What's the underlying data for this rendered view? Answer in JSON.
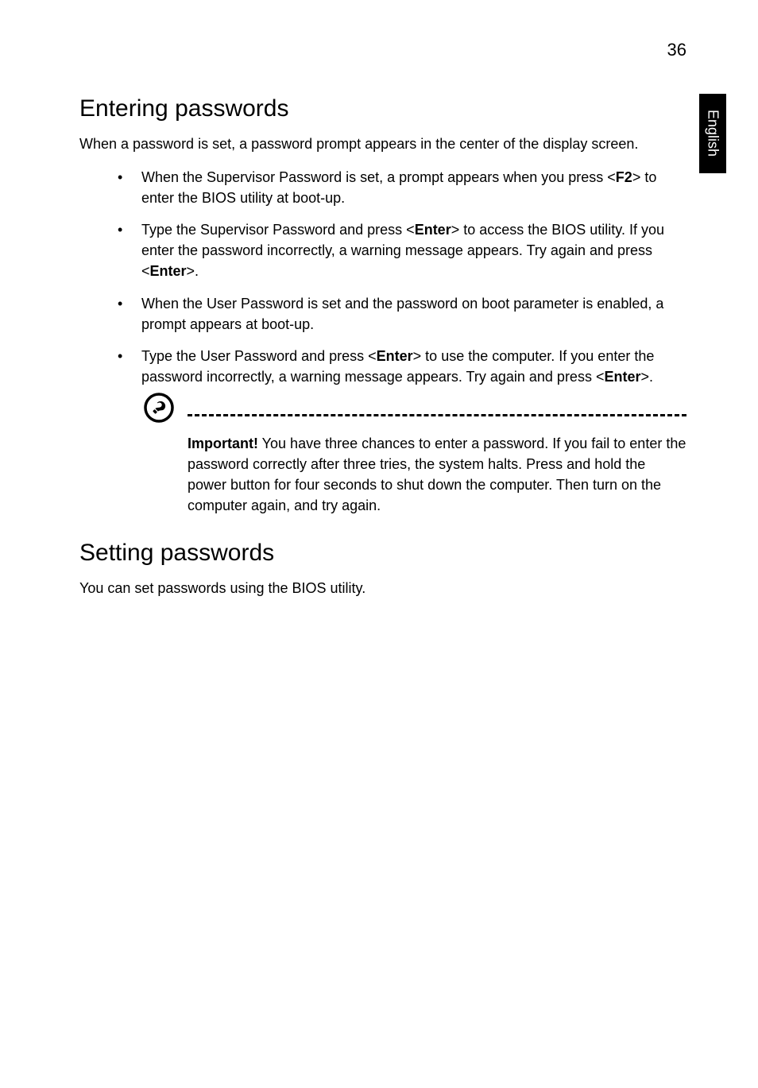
{
  "page_number": "36",
  "side_tab": "English",
  "section1": {
    "heading": "Entering passwords",
    "intro": "When a password is set, a password prompt appears in the center of the display screen.",
    "bullets": [
      {
        "pre": "When the Supervisor Password is set, a prompt appears when you press <",
        "key": "F2",
        "post": "> to enter the BIOS utility at boot-up."
      },
      {
        "pre": "Type the Supervisor Password and press <",
        "key": "Enter",
        "mid": "> to access the BIOS utility. If you enter the password incorrectly, a warning message appears. Try again and press <",
        "key2": "Enter",
        "post": ">."
      },
      {
        "pre": "When the User Password is set and the password on boot parameter is enabled, a prompt appears at boot-up."
      },
      {
        "pre": "Type the User Password and press <",
        "key": "Enter",
        "mid": "> to use the computer. If you enter the password incorrectly, a warning message appears. Try again and press <",
        "key2": "Enter",
        "post": ">."
      }
    ],
    "note_label": "Important!",
    "note_text": " You have three chances to enter a password. If you fail to enter the password correctly after three tries, the system halts. Press and hold the power button for four seconds to shut down the computer. Then turn on the computer again, and try again."
  },
  "section2": {
    "heading": "Setting passwords",
    "body": "You can set passwords using the BIOS utility."
  }
}
